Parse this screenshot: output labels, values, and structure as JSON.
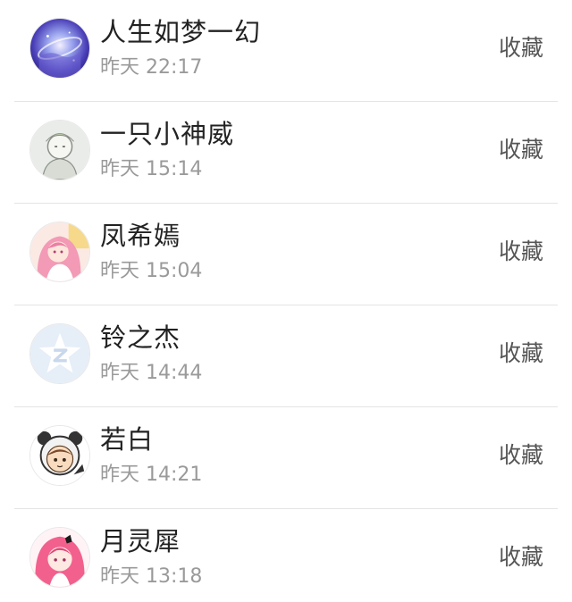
{
  "action_label": "收藏",
  "items": [
    {
      "name": "人生如梦一幻",
      "time": "昨天 22:17",
      "avatar_icon": "galaxy-avatar-icon"
    },
    {
      "name": "一只小神威",
      "time": "昨天 15:14",
      "avatar_icon": "sketch-character-avatar-icon"
    },
    {
      "name": "凤希嫣",
      "time": "昨天 15:04",
      "avatar_icon": "pink-anime-girl-avatar-icon"
    },
    {
      "name": "铃之杰",
      "time": "昨天 14:44",
      "avatar_icon": "qq-default-avatar-icon"
    },
    {
      "name": "若白",
      "time": "昨天 14:21",
      "avatar_icon": "panda-hood-boy-avatar-icon"
    },
    {
      "name": "月灵犀",
      "time": "昨天 13:18",
      "avatar_icon": "pink-hair-girl-avatar-icon"
    }
  ],
  "colors": {
    "name_text": "#222222",
    "time_text": "#9a9a9a",
    "action_text": "#555555",
    "divider": "#e4e4e4"
  }
}
